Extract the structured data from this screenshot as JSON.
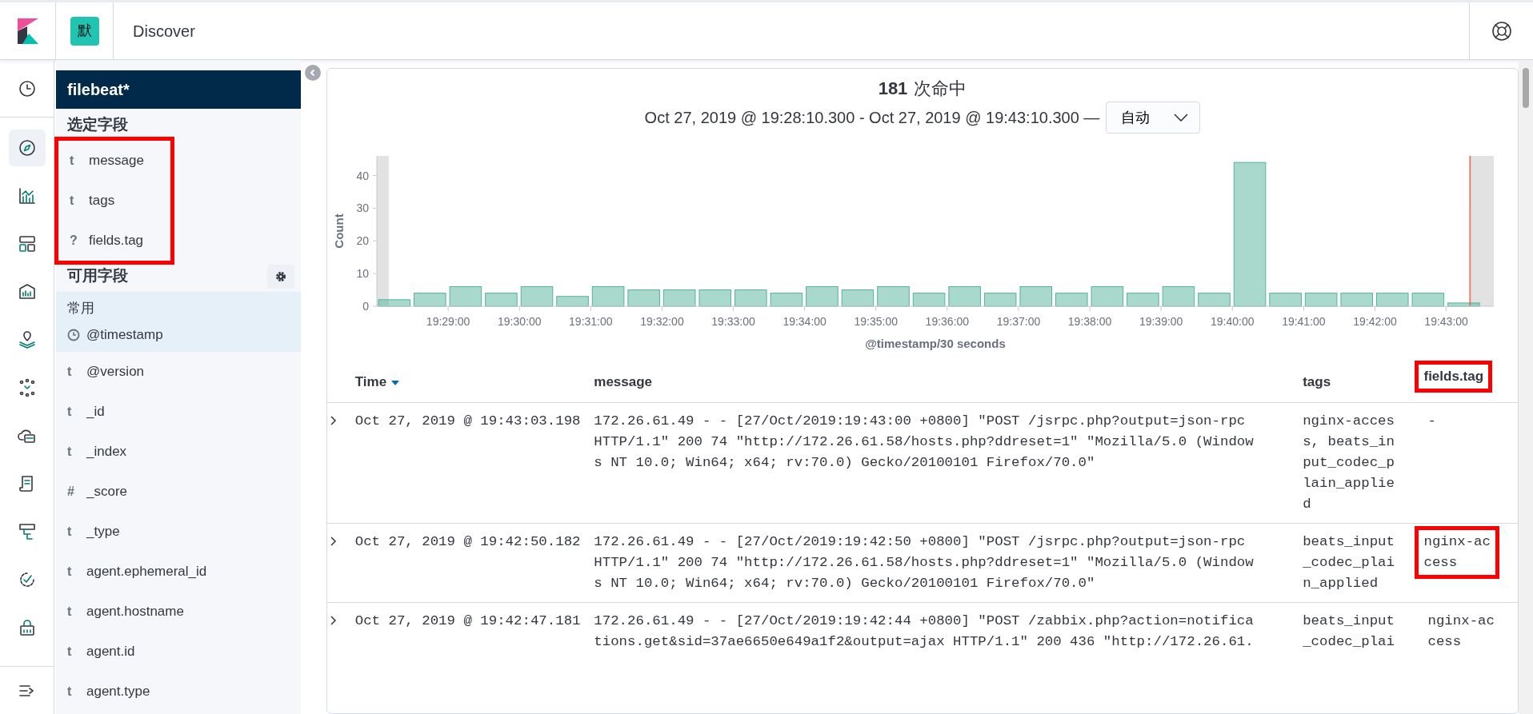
{
  "header": {
    "space_badge": "默",
    "title": "Discover"
  },
  "nav": {
    "items": [
      {
        "selected": false
      },
      {
        "selected": true
      },
      {
        "selected": false
      },
      {
        "selected": false
      },
      {
        "selected": false
      },
      {
        "selected": false
      },
      {
        "selected": false
      },
      {
        "selected": false
      },
      {
        "selected": false
      },
      {
        "selected": false
      },
      {
        "selected": false
      },
      {
        "selected": false
      },
      {
        "selected": false
      }
    ]
  },
  "sidebar": {
    "index_pattern": "filebeat*",
    "selected_heading": "选定字段",
    "selected_highlighted": true,
    "selected_fields": [
      {
        "kind": "glyph",
        "glyph": "t",
        "name": "message"
      },
      {
        "kind": "glyph",
        "glyph": "t",
        "name": "tags"
      },
      {
        "kind": "glyph",
        "glyph": "?",
        "name": "fields.tag"
      }
    ],
    "available_heading": "可用字段",
    "popular_heading": "常用",
    "popular_fields": [
      {
        "kind": "date",
        "name": "@timestamp"
      }
    ],
    "available_fields": [
      {
        "kind": "glyph",
        "glyph": "t",
        "name": "@version"
      },
      {
        "kind": "glyph",
        "glyph": "t",
        "name": "_id"
      },
      {
        "kind": "glyph",
        "glyph": "t",
        "name": "_index"
      },
      {
        "kind": "glyph",
        "glyph": "#",
        "name": "_score"
      },
      {
        "kind": "glyph",
        "glyph": "t",
        "name": "_type"
      },
      {
        "kind": "glyph",
        "glyph": "t",
        "name": "agent.ephemeral_id"
      },
      {
        "kind": "glyph",
        "glyph": "t",
        "name": "agent.hostname"
      },
      {
        "kind": "glyph",
        "glyph": "t",
        "name": "agent.id"
      },
      {
        "kind": "glyph",
        "glyph": "t",
        "name": "agent.type"
      }
    ]
  },
  "hits": {
    "count": "181",
    "label": "次命中",
    "range": "Oct 27, 2019 @ 19:28:10.300 - Oct 27, 2019 @ 19:43:10.300 —",
    "interval": "自动",
    "chart_data": {
      "type": "bar",
      "xlabel": "@timestamp/30 seconds",
      "ylabel": "Count",
      "categories": [
        null,
        null,
        "19:29:00",
        null,
        "19:30:00",
        null,
        "19:31:00",
        null,
        "19:32:00",
        null,
        "19:33:00",
        null,
        "19:34:00",
        null,
        "19:35:00",
        null,
        "19:36:00",
        null,
        "19:37:00",
        null,
        "19:38:00",
        null,
        "19:39:00",
        null,
        "19:40:00",
        null,
        "19:41:00",
        null,
        "19:42:00",
        null,
        "19:43:00"
      ],
      "series": [
        {
          "color": "#54b399",
          "values": [
            2,
            4,
            6,
            4,
            6,
            3,
            6,
            5,
            5,
            5,
            5,
            4,
            6,
            5,
            6,
            4,
            6,
            4,
            6,
            4,
            6,
            4,
            6,
            4,
            44,
            4,
            4,
            4,
            4,
            4,
            1
          ]
        }
      ],
      "ylim": [
        0,
        46
      ],
      "yticks": [
        0,
        10,
        20,
        30,
        40
      ]
    }
  },
  "table": {
    "columns": [
      {
        "label": "Time",
        "sorted": true,
        "highlighted": false
      },
      {
        "label": "message",
        "sorted": false,
        "highlighted": false
      },
      {
        "label": "tags",
        "sorted": false,
        "highlighted": false
      },
      {
        "label": "fields.tag",
        "sorted": false,
        "highlighted": true
      }
    ],
    "rows": [
      {
        "time": "Oct 27, 2019 @ 19:43:03.198",
        "message": "172.26.61.49 - - [27/Oct/2019:19:43:00 +0800] \"POST /jsrpc.php?output=json-rpc HTTP/1.1\" 200 74 \"http://172.26.61.58/hosts.php?ddreset=1\" \"Mozilla/5.0 (Windows NT 10.0; Win64; x64; rv:70.0) Gecko/20100101 Firefox/70.0\"",
        "tags": "nginx-access, beats_input_codec_plain_applied",
        "fields_tag": "-",
        "tag_highlighted": false
      },
      {
        "time": "Oct 27, 2019 @ 19:42:50.182",
        "message": "172.26.61.49 - - [27/Oct/2019:19:42:50 +0800] \"POST /jsrpc.php?output=json-rpc HTTP/1.1\" 200 74 \"http://172.26.61.58/hosts.php?ddreset=1\" \"Mozilla/5.0 (Windows NT 10.0; Win64; x64; rv:70.0) Gecko/20100101 Firefox/70.0\"",
        "tags": "beats_input_codec_plain_applied",
        "fields_tag": "nginx-access",
        "tag_highlighted": true
      },
      {
        "time": "Oct 27, 2019 @ 19:42:47.181",
        "message": "172.26.61.49 - - [27/Oct/2019:19:42:44 +0800] \"POST /zabbix.php?action=notifications.get&sid=37ae6650e649a1f2&output=ajax HTTP/1.1\" 200 436 \"http://172.26.61.",
        "tags": "beats_input_codec_plai",
        "fields_tag": "nginx-access",
        "tag_highlighted": false
      }
    ]
  }
}
